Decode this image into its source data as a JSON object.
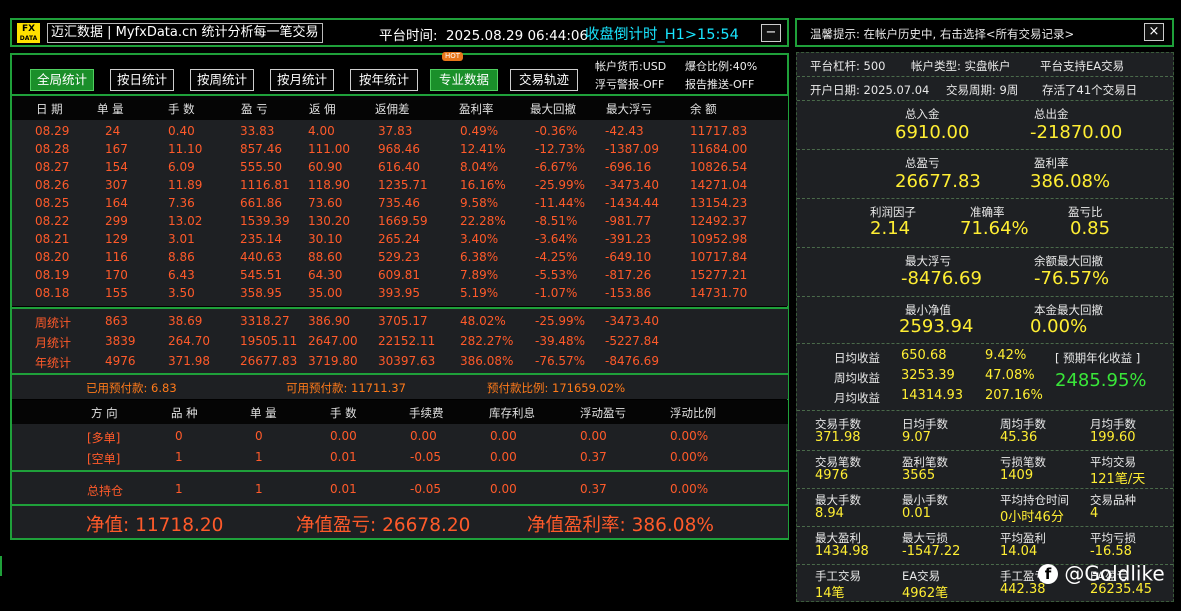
{
  "header": {
    "logo_top": "FX",
    "logo_bottom": "DATA",
    "site": "迈汇数据 | MyfxData.cn  统计分析每一笔交易",
    "platform_time_label": "平台时间:",
    "platform_time": "2025.08.29 06:44:06",
    "countdown": "收盘倒计时_H1>15:54",
    "close_label": "−"
  },
  "toolbar": {
    "buttons": [
      "全局统计",
      "按日统计",
      "按周统计",
      "按月统计",
      "按年统计",
      "专业数据",
      "交易轨迹"
    ],
    "hot_badge": "HOT",
    "account_currency": "帐户货币:USD",
    "float_alert": "浮亏警报-OFF",
    "margin_ratio": "爆仓比例:40%",
    "report_push": "报告推送-OFF"
  },
  "daily_table": {
    "headers": [
      "日 期",
      "单 量",
      "手 数",
      "盈 亏",
      "返 佣",
      "返佣差",
      "盈利率",
      "最大回撤",
      "最大浮亏",
      "余 额"
    ],
    "rows": [
      [
        "08.29",
        "24",
        "0.40",
        "33.83",
        "4.00",
        "37.83",
        "0.49%",
        "-0.36%",
        "-42.43",
        "11717.83"
      ],
      [
        "08.28",
        "167",
        "11.10",
        "857.46",
        "111.00",
        "968.46",
        "12.41%",
        "-12.73%",
        "-1387.09",
        "11684.00"
      ],
      [
        "08.27",
        "154",
        "6.09",
        "555.50",
        "60.90",
        "616.40",
        "8.04%",
        "-6.67%",
        "-696.16",
        "10826.54"
      ],
      [
        "08.26",
        "307",
        "11.89",
        "1116.81",
        "118.90",
        "1235.71",
        "16.16%",
        "-25.99%",
        "-3473.40",
        "14271.04"
      ],
      [
        "08.25",
        "164",
        "7.36",
        "661.86",
        "73.60",
        "735.46",
        "9.58%",
        "-11.44%",
        "-1434.44",
        "13154.23"
      ],
      [
        "08.22",
        "299",
        "13.02",
        "1539.39",
        "130.20",
        "1669.59",
        "22.28%",
        "-8.51%",
        "-981.77",
        "12492.37"
      ],
      [
        "08.21",
        "129",
        "3.01",
        "235.14",
        "30.10",
        "265.24",
        "3.40%",
        "-3.64%",
        "-391.23",
        "10952.98"
      ],
      [
        "08.20",
        "116",
        "8.86",
        "440.63",
        "88.60",
        "529.23",
        "6.38%",
        "-4.25%",
        "-649.10",
        "10717.84"
      ],
      [
        "08.19",
        "170",
        "6.43",
        "545.51",
        "64.30",
        "609.81",
        "7.89%",
        "-5.53%",
        "-817.26",
        "15277.21"
      ],
      [
        "08.18",
        "155",
        "3.50",
        "358.95",
        "35.00",
        "393.95",
        "5.19%",
        "-1.07%",
        "-153.86",
        "14731.70"
      ]
    ]
  },
  "summary_rows": [
    [
      "周统计",
      "863",
      "38.69",
      "3318.27",
      "386.90",
      "3705.17",
      "48.02%",
      "-25.99%",
      "-3473.40"
    ],
    [
      "月统计",
      "3839",
      "264.70",
      "19505.11",
      "2647.00",
      "22152.11",
      "282.27%",
      "-39.48%",
      "-5227.84"
    ],
    [
      "年统计",
      "4976",
      "371.98",
      "26677.83",
      "3719.80",
      "30397.63",
      "386.08%",
      "-76.57%",
      "-8476.69"
    ]
  ],
  "margin_line": {
    "used": "已用预付款: 6.83",
    "available": "可用预付款: 11711.37",
    "ratio": "预付款比例: 171659.02%"
  },
  "position_table": {
    "headers": [
      "方 向",
      "品 种",
      "单 量",
      "手 数",
      "手续费",
      "库存利息",
      "浮动盈亏",
      "浮动比例"
    ],
    "rows": [
      [
        "[多单]",
        "0",
        "0",
        "0.00",
        "0.00",
        "0.00",
        "0.00",
        "0.00%"
      ],
      [
        "[空单]",
        "1",
        "1",
        "0.01",
        "-0.05",
        "0.00",
        "0.37",
        "0.00%"
      ]
    ],
    "total": [
      "总持仓",
      "1",
      "1",
      "0.01",
      "-0.05",
      "0.00",
      "0.37",
      "0.00%"
    ]
  },
  "bottom": {
    "net_value": "净值:  11718.20",
    "net_profit": "净值盈亏:  26678.20",
    "net_rate": "净值盈利率:  386.08%"
  },
  "right": {
    "tip": "温馨提示: 在帐户历史中, 右击选择<所有交易记录>",
    "close_label": "×",
    "leverage": "平台杠杆:  500",
    "account_type": "帐户类型:  实盘帐户",
    "ea_support": "平台支持EA交易",
    "open_date": "开户日期:  2025.07.04",
    "cycle": "交易周期:  9周",
    "stored": "存活了41个交易日",
    "big": [
      {
        "label": "总入金",
        "value": "6910.00"
      },
      {
        "label": "总出金",
        "value": "-21870.00"
      },
      {
        "label": "总盈亏",
        "value": "26677.83"
      },
      {
        "label": "盈利率",
        "value": "386.08%"
      },
      {
        "label": "利润因子",
        "value": "2.14"
      },
      {
        "label": "准确率",
        "value": "71.64%"
      },
      {
        "label": "盈亏比",
        "value": "0.85"
      },
      {
        "label": "最大浮亏",
        "value": "-8476.69"
      },
      {
        "label": "余额最大回撤",
        "value": "-76.57%"
      },
      {
        "label": "最小净值",
        "value": "2593.94"
      },
      {
        "label": "本金最大回撤",
        "value": "0.00%"
      }
    ],
    "avg": {
      "day_label": "日均收益",
      "day_val": "650.68",
      "day_pct": "9.42%",
      "week_label": "周均收益",
      "week_val": "3253.39",
      "week_pct": "47.08%",
      "month_label": "月均收益",
      "month_val": "14314.93",
      "month_pct": "207.16%",
      "annual_label": "[ 预期年化收益 ]",
      "annual_val": "2485.95%"
    },
    "stats": [
      [
        {
          "l": "交易手数",
          "v": "371.98"
        },
        {
          "l": "日均手数",
          "v": "9.07"
        },
        {
          "l": "周均手数",
          "v": "45.36"
        },
        {
          "l": "月均手数",
          "v": "199.60"
        }
      ],
      [
        {
          "l": "交易笔数",
          "v": "4976"
        },
        {
          "l": "盈利笔数",
          "v": "3565"
        },
        {
          "l": "亏损笔数",
          "v": "1409"
        },
        {
          "l": "平均交易",
          "v": "121笔/天"
        }
      ],
      [
        {
          "l": "最大手数",
          "v": "8.94"
        },
        {
          "l": "最小手数",
          "v": "0.01"
        },
        {
          "l": "平均持仓时间",
          "v": "0小时46分"
        },
        {
          "l": "交易品种",
          "v": "4"
        }
      ],
      [
        {
          "l": "最大盈利",
          "v": "1434.98"
        },
        {
          "l": "最大亏损",
          "v": "-1547.22"
        },
        {
          "l": "平均盈利",
          "v": "14.04"
        },
        {
          "l": "平均亏损",
          "v": "-16.58"
        }
      ],
      [
        {
          "l": "手工交易",
          "v": "14笔"
        },
        {
          "l": "EA交易",
          "v": "4962笔"
        },
        {
          "l": "手工盈亏",
          "v": "442.38"
        },
        {
          "l": "EA盈亏",
          "v": "26235.45"
        }
      ]
    ],
    "watermark": "@Goldlike"
  },
  "colors": {
    "accent_green": "#1fa03a",
    "value_yellow": "#ffee33",
    "loss_red": "#ff4d2a",
    "countdown_cyan": "#19e6ff"
  }
}
